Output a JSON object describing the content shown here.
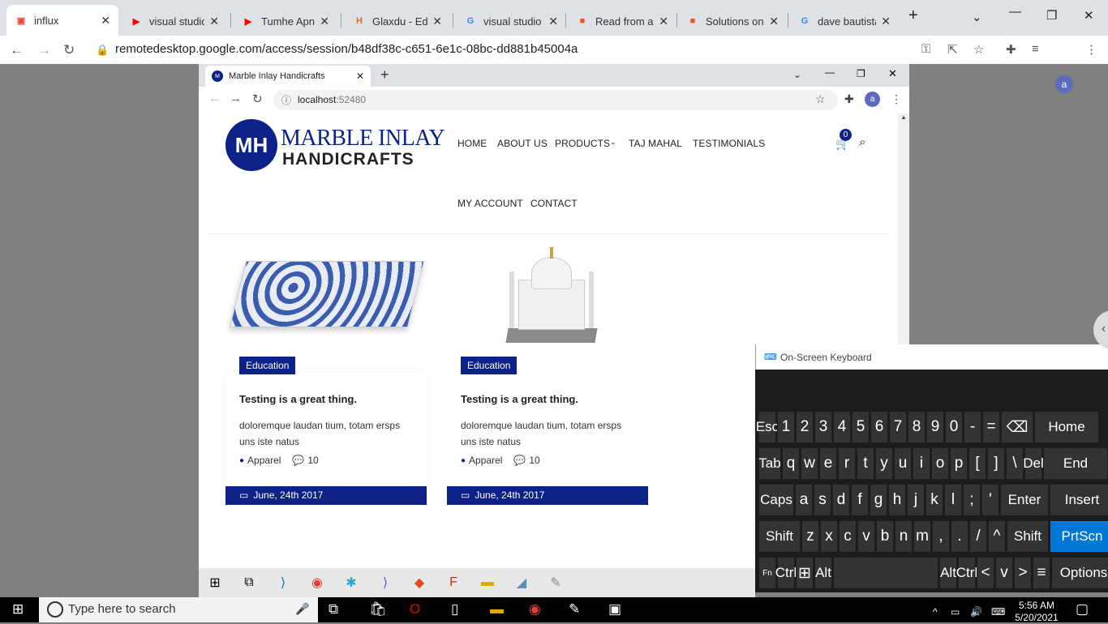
{
  "outer_tabs": [
    {
      "title": "influx",
      "icon": "chrome-remote-desktop-icon",
      "color": "#e14a39"
    },
    {
      "title": "visual studio c",
      "icon": "youtube-icon",
      "color": "#ff0000"
    },
    {
      "title": "Tumhe Apna",
      "icon": "youtube-icon",
      "color": "#ff0000"
    },
    {
      "title": "Glaxdu - Educ",
      "icon": "glaxdu-icon",
      "color": "#e06b2b"
    },
    {
      "title": "visual studio c",
      "icon": "google-icon",
      "color": "#4285f4"
    },
    {
      "title": "Read from an",
      "icon": "microsoft-icon",
      "color": "#f25022"
    },
    {
      "title": "Solutions on",
      "icon": "microsoft-icon",
      "color": "#f25022"
    },
    {
      "title": "dave bautista",
      "icon": "google-icon",
      "color": "#4285f4"
    }
  ],
  "outer_url": "remotedesktop.google.com/access/session/b48df38c-c651-6e1c-08bc-dd881b45004a",
  "outer_avatar": "a",
  "inner_tab": {
    "title": "Marble Inlay Handicrafts"
  },
  "inner_url": {
    "host": "localhost",
    "port": ":52480"
  },
  "inner_avatar": "a",
  "site": {
    "logo_line1": "MARBLE INLAY",
    "logo_line2": "HANDICRAFTS",
    "logo_mark": "MH",
    "nav": {
      "home": "HOME",
      "about": "ABOUT US",
      "products": "PRODUCTS",
      "taj": "TAJ MAHAL",
      "testimonials": "TESTIMONIALS",
      "account": "MY ACCOUNT",
      "contact": "CONTACT"
    },
    "cart_count": "0",
    "accent": "#0d2288",
    "cards": [
      {
        "badge": "Education",
        "title": "Testing is a great thing.",
        "text": "doloremque laudan tium, totam ersps uns iste natus",
        "category": "Apparel",
        "comments": "10",
        "date": "June, 24th 2017"
      },
      {
        "badge": "Education",
        "title": "Testing is a great thing.",
        "text": "doloremque laudan tium, totam ersps uns iste natus",
        "category": "Apparel",
        "comments": "10",
        "date": "June, 24th 2017"
      }
    ]
  },
  "osk": {
    "title": "On-Screen Keyboard",
    "row1": [
      "Esc",
      "1",
      "2",
      "3",
      "4",
      "5",
      "6",
      "7",
      "8",
      "9",
      "0",
      "-",
      "=",
      "⌫",
      "Home"
    ],
    "row2": [
      "Tab",
      "q",
      "w",
      "e",
      "r",
      "t",
      "y",
      "u",
      "i",
      "o",
      "p",
      "[",
      "]",
      "\\",
      "Del",
      "End"
    ],
    "row3": [
      "Caps",
      "a",
      "s",
      "d",
      "f",
      "g",
      "h",
      "j",
      "k",
      "l",
      ";",
      "'",
      "Enter",
      "Insert"
    ],
    "row4": [
      "Shift",
      "z",
      "x",
      "c",
      "v",
      "b",
      "n",
      "m",
      ",",
      ".",
      "/",
      "^",
      "Shift",
      "PrtScn"
    ],
    "row5": [
      "Fn",
      "Ctrl",
      "⊞",
      "Alt",
      "",
      "Alt",
      "Ctrl",
      "<",
      "v",
      ">",
      "≡",
      "Options"
    ]
  },
  "taskbar": {
    "search_placeholder": "Type here to search",
    "time": "5:56 AM",
    "date": "5/20/2021"
  }
}
